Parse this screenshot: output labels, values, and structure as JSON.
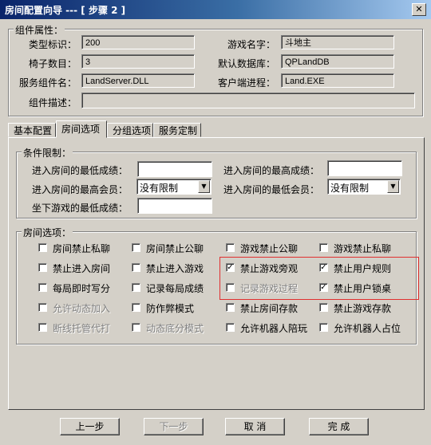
{
  "window": {
    "title": "房间配置向导 --- [ 步骤 2 ]"
  },
  "component": {
    "legend": "组件属性：",
    "type_id_label": "类型标识：",
    "type_id": "200",
    "game_name_label": "游戏名字：",
    "game_name": "斗地主",
    "chair_count_label": "椅子数目：",
    "chair_count": "3",
    "default_db_label": "默认数据库：",
    "default_db": "QPLandDB",
    "service_label": "服务组件名：",
    "service": "LandServer.DLL",
    "client_label": "客户端进程：",
    "client": "Land.EXE",
    "desc_label": "组件描述：",
    "desc": ""
  },
  "tabs": [
    {
      "label": "基本配置"
    },
    {
      "label": "房间选项"
    },
    {
      "label": "分组选项"
    },
    {
      "label": "服务定制"
    }
  ],
  "conditions": {
    "legend": "条件限制：",
    "min_score_label": "进入房间的最低成绩：",
    "min_score": "",
    "max_score_label": "进入房间的最高成绩：",
    "max_score": "",
    "max_member_label": "进入房间的最高会员：",
    "max_member": "没有限制",
    "min_member_label": "进入房间的最低会员：",
    "min_member": "没有限制",
    "sit_min_label": "坐下游戏的最低成绩：",
    "sit_min": ""
  },
  "room_options": {
    "legend": "房间选项：",
    "items": [
      {
        "label": "房间禁止私聊",
        "checked": false,
        "disabled": false
      },
      {
        "label": "房间禁止公聊",
        "checked": false,
        "disabled": false
      },
      {
        "label": "游戏禁止公聊",
        "checked": false,
        "disabled": false
      },
      {
        "label": "游戏禁止私聊",
        "checked": false,
        "disabled": false
      },
      {
        "label": "禁止进入房间",
        "checked": false,
        "disabled": false
      },
      {
        "label": "禁止进入游戏",
        "checked": false,
        "disabled": false
      },
      {
        "label": "禁止游戏旁观",
        "checked": true,
        "disabled": false
      },
      {
        "label": "禁止用户规则",
        "checked": true,
        "disabled": false
      },
      {
        "label": "每局即时写分",
        "checked": false,
        "disabled": false
      },
      {
        "label": "记录每局成绩",
        "checked": false,
        "disabled": false
      },
      {
        "label": "记录游戏过程",
        "checked": false,
        "disabled": true
      },
      {
        "label": "禁止用户锁桌",
        "checked": true,
        "disabled": false
      },
      {
        "label": "允许动态加入",
        "checked": false,
        "disabled": true
      },
      {
        "label": "防作弊模式",
        "checked": false,
        "disabled": false
      },
      {
        "label": "禁止房间存款",
        "checked": false,
        "disabled": false
      },
      {
        "label": "禁止游戏存款",
        "checked": false,
        "disabled": false
      },
      {
        "label": "断线托管代打",
        "checked": false,
        "disabled": true
      },
      {
        "label": "动态底分模式",
        "checked": false,
        "disabled": true
      },
      {
        "label": "允许机器人陪玩",
        "checked": false,
        "disabled": false
      },
      {
        "label": "允许机器人占位",
        "checked": false,
        "disabled": false
      }
    ]
  },
  "buttons": {
    "prev": "上一步",
    "next": "下一步",
    "cancel": "取 消",
    "finish": "完 成"
  },
  "icons": {
    "close": "close-icon",
    "dropdown": "chevron-down-icon",
    "check": "checkmark-icon"
  }
}
